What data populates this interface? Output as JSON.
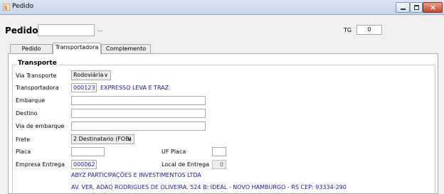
{
  "window": {
    "title": "Pedido"
  },
  "header": {
    "pedido_label": "Pedido",
    "pedido_value": "",
    "lookup_dots": "...",
    "tg_label": "TG",
    "tg_value": "0"
  },
  "tabs": [
    {
      "label": "Pedido",
      "active": false
    },
    {
      "label": "Transportadora",
      "active": true
    },
    {
      "label": "Complemento",
      "active": false
    }
  ],
  "transporte": {
    "group_title": "Transporte",
    "via_transporte": {
      "label": "Via Transporte",
      "value": "Rodoviária"
    },
    "transportadora": {
      "label": "Transportadora",
      "code": "000123",
      "name": "EXPRESSO LEVA E TRAZ"
    },
    "embarque": {
      "label": "Embarque",
      "value": ""
    },
    "destino": {
      "label": "Destino",
      "value": ""
    },
    "via_embarque": {
      "label": "Via de embarque",
      "value": ""
    },
    "frete": {
      "label": "Frete",
      "value": "2 Destinatario (FOB)"
    },
    "placa": {
      "label": "Placa",
      "value": ""
    },
    "uf_placa": {
      "label": "UF Placa",
      "value": ""
    },
    "empresa_entrega": {
      "label": "Empresa Entrega",
      "code": "000062"
    },
    "local_entrega": {
      "label": "Local de Entrega",
      "value": "0"
    },
    "empresa_nome": "ABYZ PARTICIPAÇÕES E INVESTIMENTOS LTDA",
    "empresa_endereco": "AV. VER. ADAO RODRIGUES DE OLIVEIRA, 524 B: IDEAL - NOVO HAMBURGO - RS CEP: 93334-290"
  },
  "icons": [
    "app-icon",
    "minimize-icon",
    "maximize-icon",
    "close-icon",
    "chevron-down-icon"
  ]
}
